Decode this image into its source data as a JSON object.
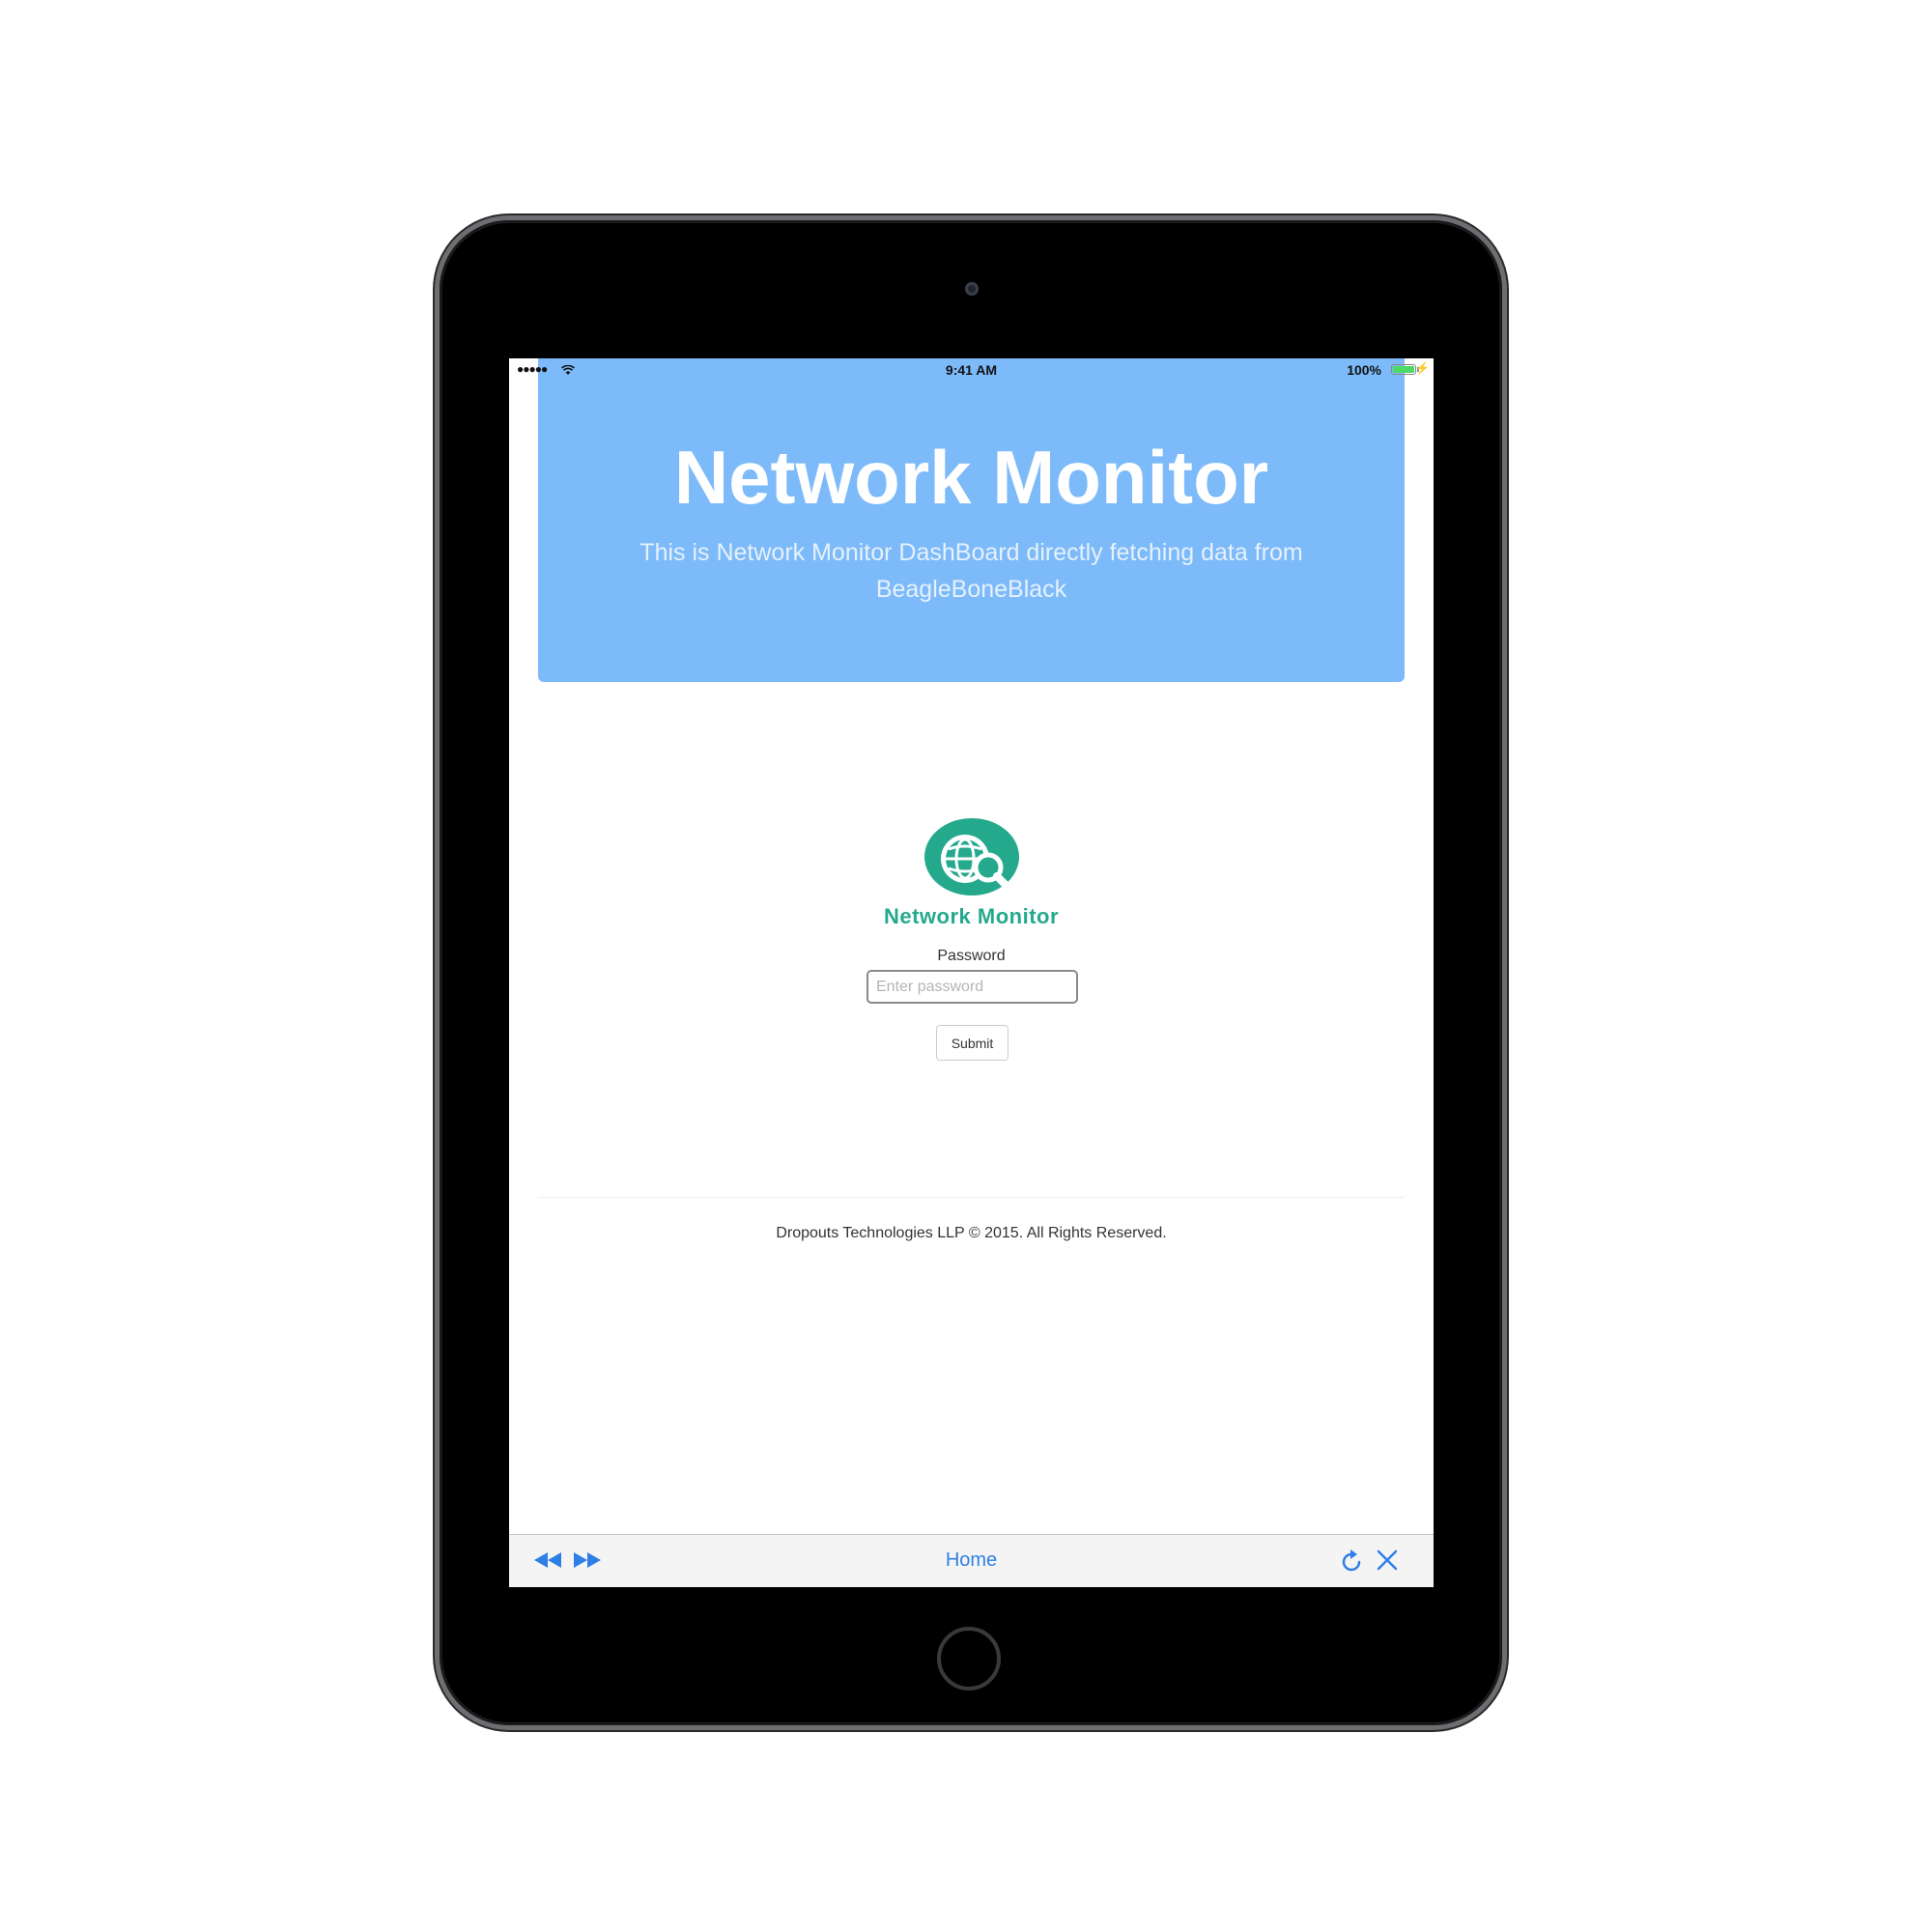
{
  "status_bar": {
    "signal": "●●●●●",
    "time": "9:41 AM",
    "battery": "100%"
  },
  "header": {
    "title": "Network Monitor",
    "subtitle": "This is Network Monitor DashBoard directly fetching data from BeagleBoneBlack"
  },
  "logo": {
    "text": "Network Monitor",
    "icon": "globe-search-icon"
  },
  "form": {
    "password_label": "Password",
    "password_placeholder": "Enter password",
    "password_value": "",
    "submit_label": "Submit"
  },
  "footer": {
    "copyright": "Dropouts Technologies LLP © 2015. All Rights Reserved."
  },
  "toolbar": {
    "back_icon": "rewind-icon",
    "forward_icon": "fast-forward-icon",
    "home_label": "Home",
    "reload_icon": "reload-icon",
    "close_icon": "close-icon"
  },
  "colors": {
    "header_bg": "#7cbaf9",
    "brand_green": "#25a98d",
    "toolbar_accent": "#2f80e6",
    "battery_green": "#4cd964"
  }
}
